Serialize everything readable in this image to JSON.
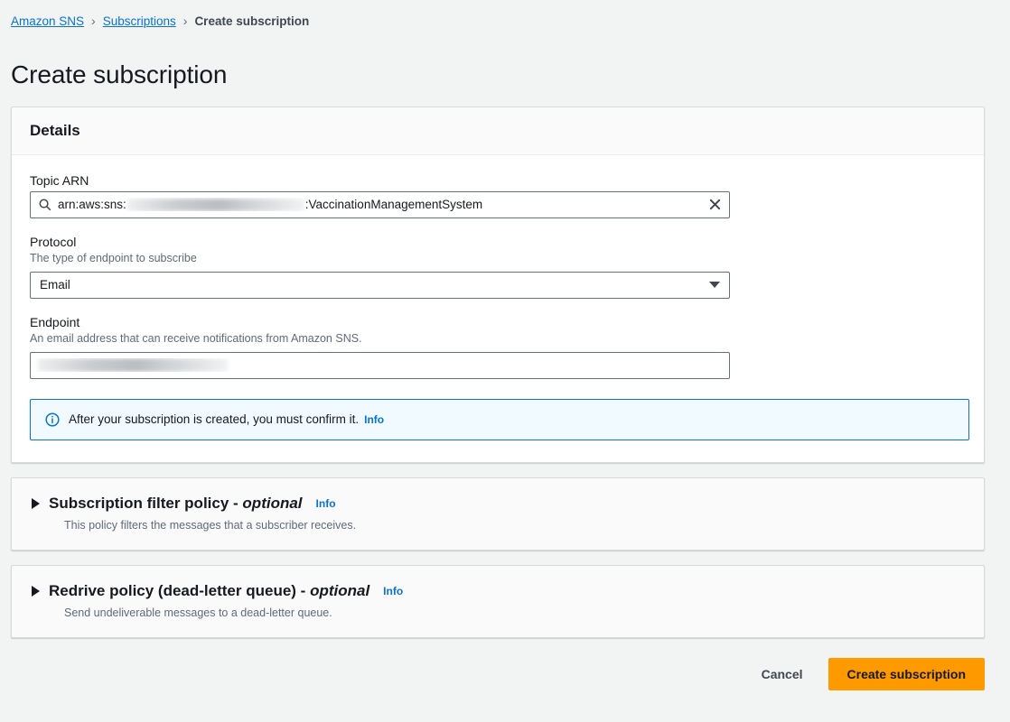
{
  "breadcrumb": {
    "items": [
      {
        "label": "Amazon SNS",
        "type": "link"
      },
      {
        "label": "Subscriptions",
        "type": "link"
      },
      {
        "label": "Create subscription",
        "type": "current"
      }
    ],
    "separator": "›"
  },
  "page": {
    "title": "Create subscription"
  },
  "details": {
    "header": "Details",
    "topic_arn": {
      "label": "Topic ARN",
      "icon": "search-icon",
      "value_prefix": "arn:aws:sns:",
      "value_suffix": ":VaccinationManagementSystem",
      "redacted": true,
      "clear_icon": "close-icon"
    },
    "protocol": {
      "label": "Protocol",
      "description": "The type of endpoint to subscribe",
      "value": "Email",
      "options": [
        "Email"
      ]
    },
    "endpoint": {
      "label": "Endpoint",
      "description": "An email address that can receive notifications from Amazon SNS.",
      "value": "",
      "redacted": true
    },
    "alert": {
      "icon": "info-circle-icon",
      "text": "After your subscription is created, you must confirm it.",
      "info_label": "Info"
    }
  },
  "sections": [
    {
      "title": "Subscription filter policy - ",
      "optional": "optional",
      "info_label": "Info",
      "description": "This policy filters the messages that a subscriber receives.",
      "expanded": false
    },
    {
      "title": "Redrive policy (dead-letter queue) - ",
      "optional": "optional",
      "info_label": "Info",
      "description": "Send undeliverable messages to a dead-letter queue.",
      "expanded": false
    }
  ],
  "footer": {
    "cancel_label": "Cancel",
    "submit_label": "Create subscription"
  },
  "colors": {
    "accent_link": "#0972d3",
    "primary_button": "#ff9900",
    "page_background": "#f2f3f3",
    "alert_background": "#f1faff"
  }
}
